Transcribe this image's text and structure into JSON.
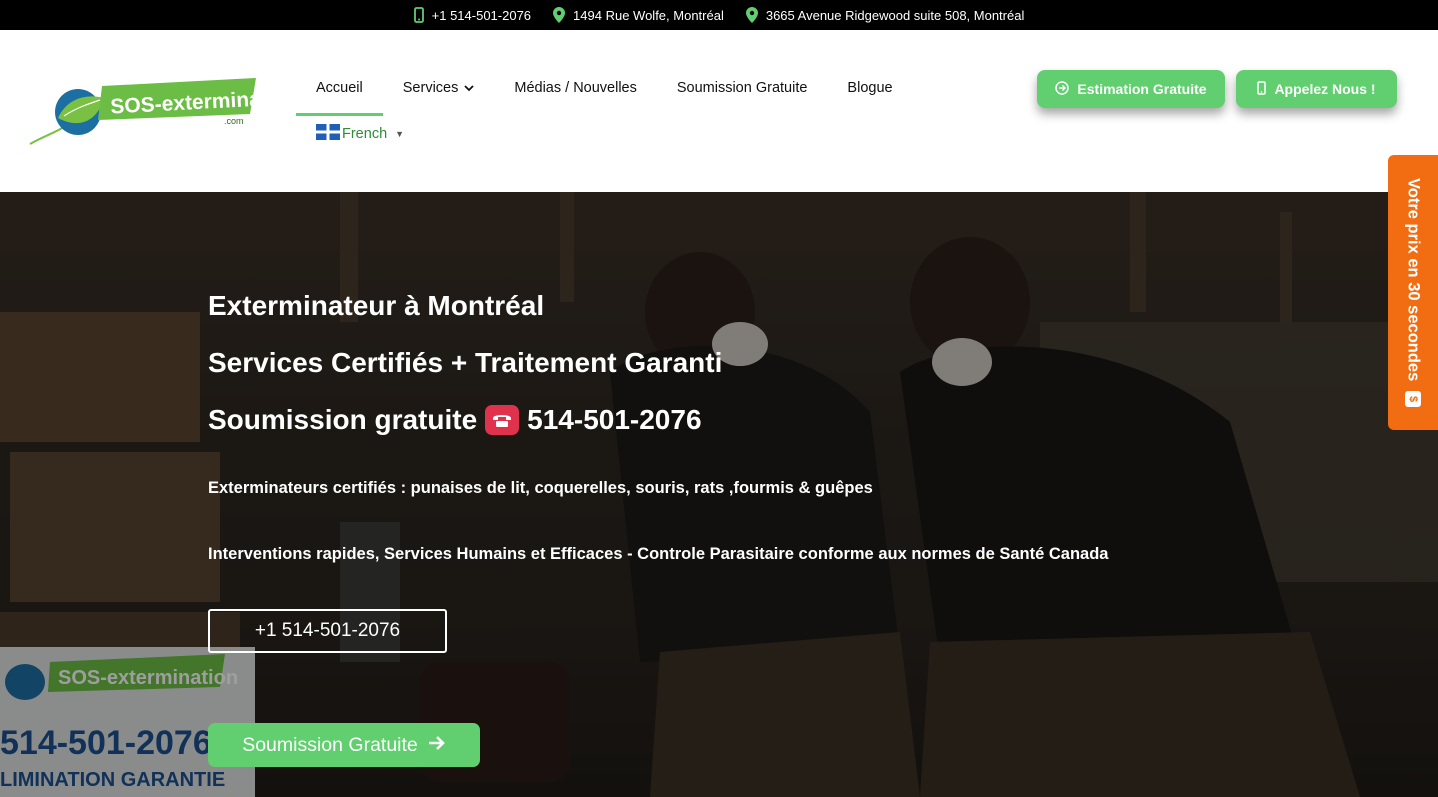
{
  "topbar": {
    "phone": "+1 514-501-2076",
    "address1": "1494 Rue Wolfe, Montréal",
    "address2": "3665 Avenue Ridgewood suite 508, Montréal"
  },
  "logo": {
    "text": "SOS-extermination",
    "sub": ".com",
    "alt": "SOS-extermination.com"
  },
  "nav": {
    "items": [
      {
        "label": "Accueil"
      },
      {
        "label": "Services"
      },
      {
        "label": "Médias / Nouvelles"
      },
      {
        "label": "Soumission Gratuite"
      },
      {
        "label": "Blogue"
      }
    ],
    "language": "French"
  },
  "header_buttons": {
    "estimate": "Estimation Gratuite",
    "call": "Appelez Nous !"
  },
  "hero": {
    "line1": "Exterminateur à Montréal",
    "line2": "Services Certifiés + Traitement Garanti",
    "line3_prefix": "Soumission gratuite",
    "line3_phone": "514-501-2076",
    "para1": "Exterminateurs certifiés : punaises de lit, coquerelles, souris, rats ,fourmis & guêpes",
    "para2": "Interventions rapides, Services Humains et Efficaces - Controle Parasitaire conforme aux normes de Santé Canada",
    "phone_button": "+1 514-501-2076",
    "cta_button": "Soumission Gratuite",
    "sign_logo": "SOS-extermination",
    "sign_phone": "514-501-2076",
    "sign_text": "LIMINATION GARANTIE"
  },
  "side_tab": {
    "label": "Votre prix en 30 secondes",
    "icon_symbol": "$"
  },
  "colors": {
    "accent_green": "#61ce70",
    "side_tab_orange": "#f26d12",
    "topbar_bg": "#000000"
  }
}
